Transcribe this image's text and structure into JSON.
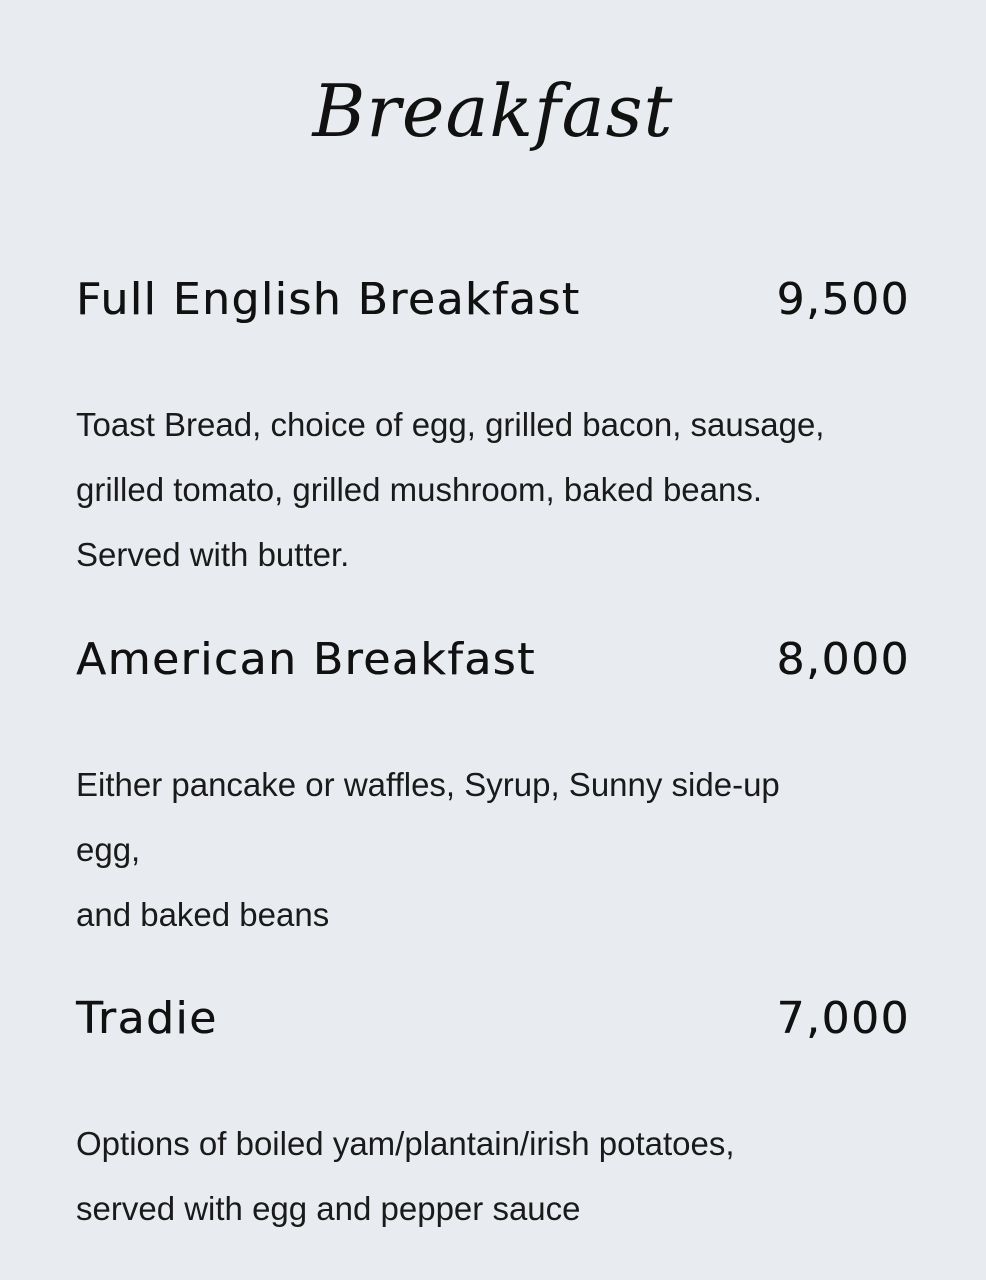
{
  "menu": {
    "title": "Breakfast",
    "items": [
      {
        "name": "Full English Breakfast",
        "price": "9,500",
        "description_lines": [
          "Toast Bread, choice of egg, grilled bacon, sausage,",
          "grilled tomato, grilled mushroom, baked beans.",
          "Served with butter."
        ]
      },
      {
        "name": "American Breakfast",
        "price": "8,000",
        "description_lines": [
          "Either pancake or waffles, Syrup, Sunny side-up",
          "egg,",
          "and baked beans"
        ]
      },
      {
        "name": "Tradie",
        "price": "7,000",
        "description_lines": [
          "Options of boiled yam/plantain/irish potatoes,",
          "served with egg and pepper sauce"
        ]
      }
    ]
  }
}
